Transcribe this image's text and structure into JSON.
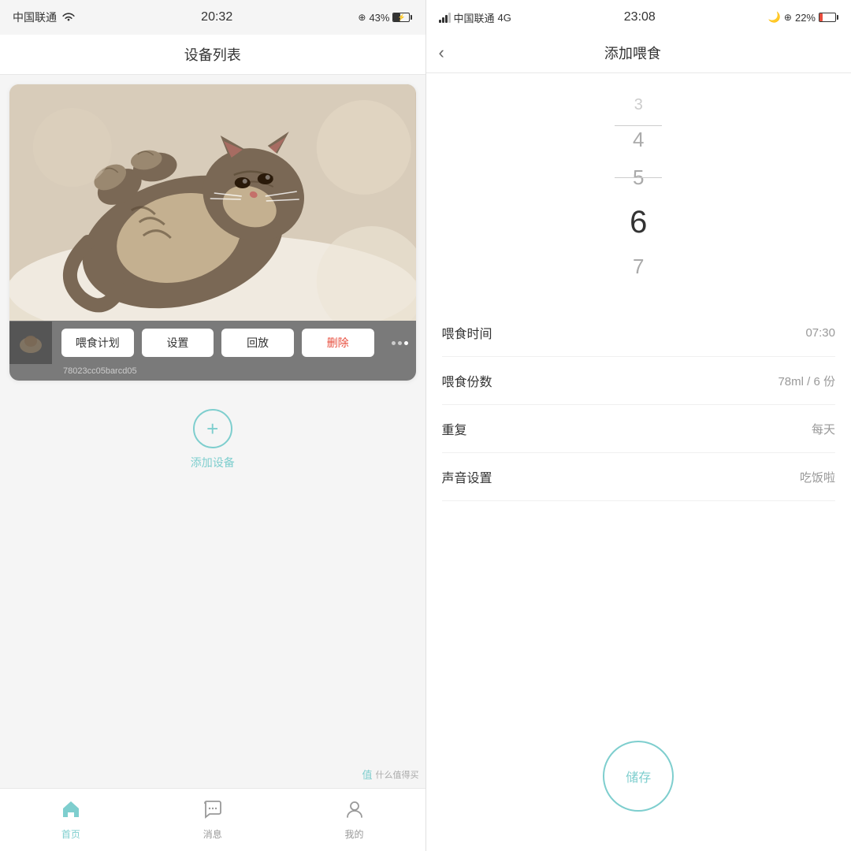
{
  "left": {
    "statusBar": {
      "carrier": "中国联通",
      "signal": "wifi",
      "time": "20:32",
      "batteryPercent": "43%"
    },
    "pageTitle": "设备列表",
    "deviceActions": {
      "btn1": "喂食计划",
      "btn2": "设置",
      "btn3": "回放",
      "btn4": "删除"
    },
    "deviceId": "78023cc05barcd05",
    "addDevice": {
      "icon": "+",
      "label": "添加设备"
    },
    "nav": {
      "items": [
        {
          "label": "首页",
          "icon": "home",
          "active": true
        },
        {
          "label": "消息",
          "icon": "chat",
          "active": false
        },
        {
          "label": "我的",
          "icon": "user",
          "active": false
        }
      ]
    },
    "watermark": "什么值得买"
  },
  "right": {
    "statusBar": {
      "carrier": "中国联通",
      "network": "4G",
      "time": "23:08",
      "batteryPercent": "22%"
    },
    "pageTitle": "添加喂食",
    "picker": {
      "items": [
        "3",
        "4",
        "5",
        "6",
        "7"
      ],
      "selectedIndex": 3
    },
    "settings": [
      {
        "label": "喂食时间",
        "value": "07:30"
      },
      {
        "label": "喂食份数",
        "value": "78ml / 6 份"
      },
      {
        "label": "重复",
        "value": "每天"
      },
      {
        "label": "声音设置",
        "value": "吃饭啦"
      }
    ],
    "saveBtn": "储存"
  }
}
